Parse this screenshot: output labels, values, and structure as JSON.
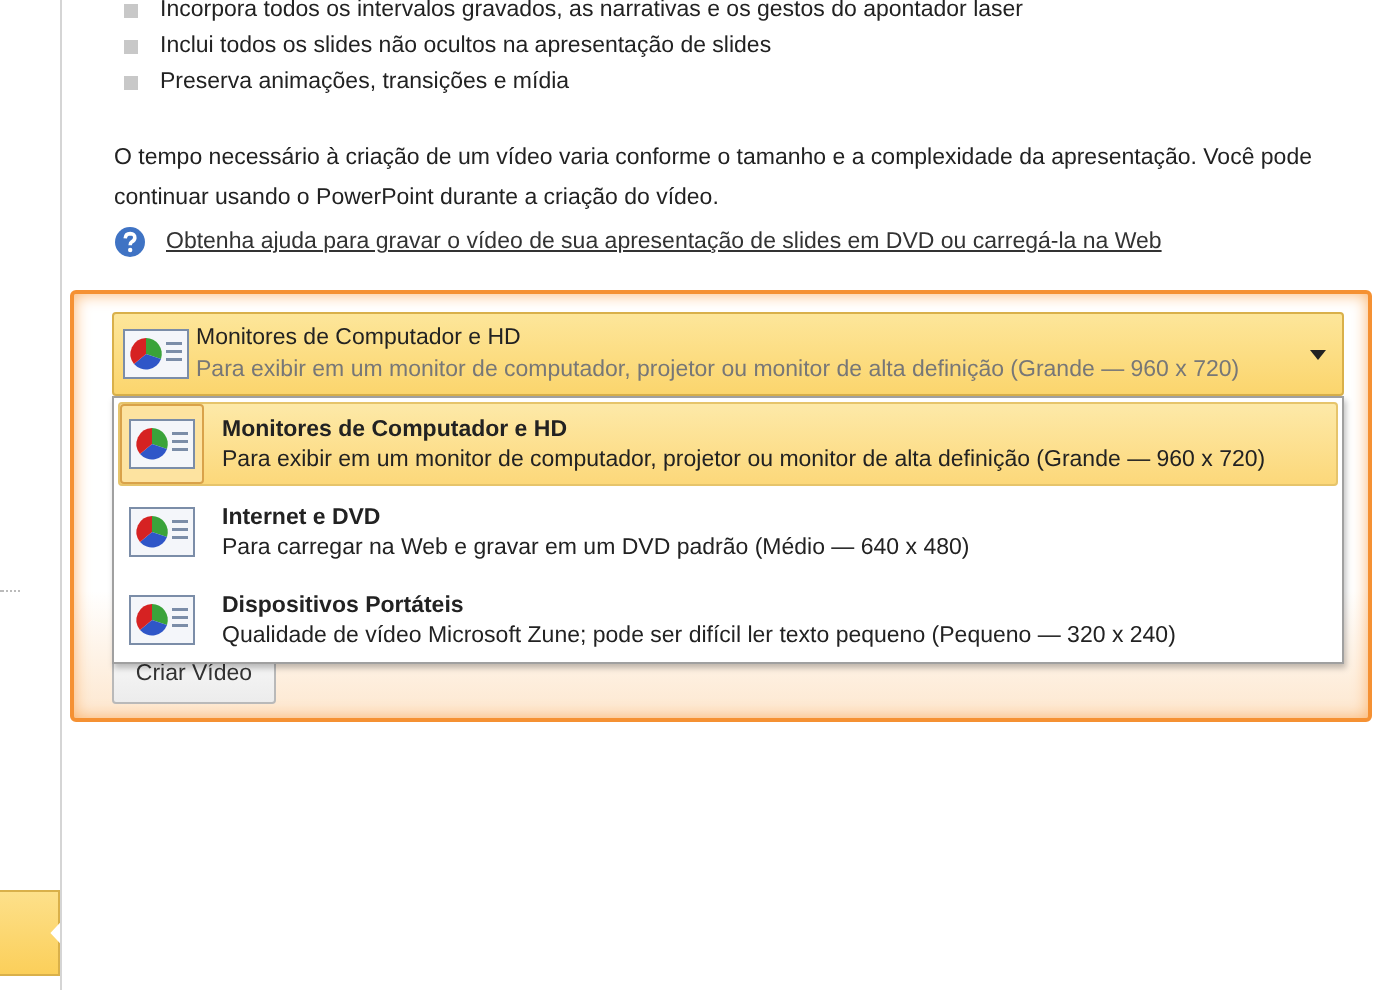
{
  "features": [
    "Incorpora todos os intervalos gravados, as narrativas e os gestos do apontador laser",
    "Inclui todos os slides não ocultos na apresentação de slides",
    "Preserva animações, transições e mídia"
  ],
  "note": "O tempo necessário à criação de um vídeo varia conforme o tamanho e a complexidade da apresentação. Você pode continuar usando o PowerPoint durante a criação do vídeo.",
  "help_link": "Obtenha ajuda para gravar o vídeo de sua apresentação de slides em DVD ou carregá-la na Web",
  "dropdown": {
    "title": "Monitores de Computador e HD",
    "description": "Para exibir em um monitor de computador, projetor ou monitor de alta definição (Grande — 960 x 720)",
    "expanded": true
  },
  "options": [
    {
      "title": "Monitores de Computador e HD",
      "description": "Para exibir em um monitor de computador, projetor ou monitor de alta definição (Grande — 960 x 720)",
      "selected": true
    },
    {
      "title": "Internet e DVD",
      "description": "Para carregar na Web e gravar em um DVD  padrão (Médio — 640 x 480)",
      "selected": false
    },
    {
      "title": "Dispositivos Portáteis",
      "description": "Qualidade de vídeo Microsoft Zune; pode ser difícil ler texto pequeno (Pequeno — 320 x 240)",
      "selected": false
    }
  ],
  "create_button": "Criar Vídeo"
}
